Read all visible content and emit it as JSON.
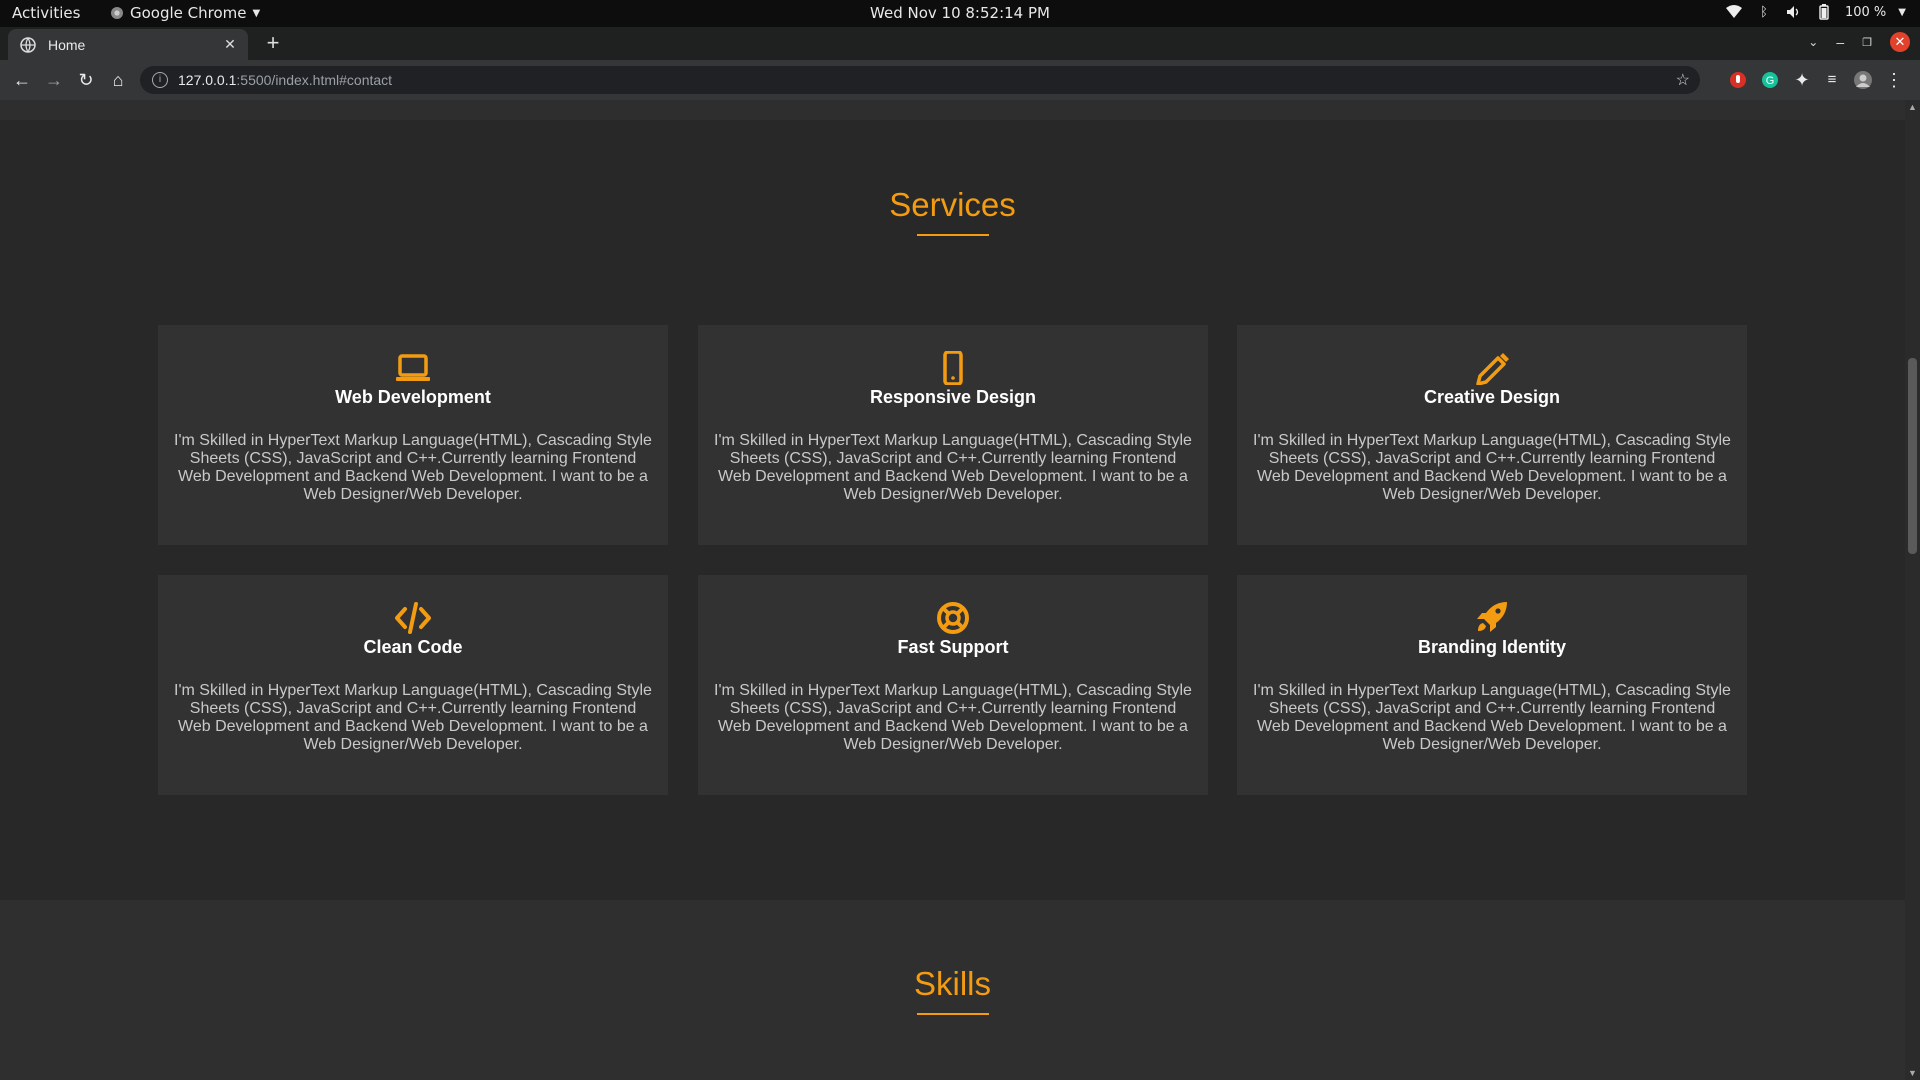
{
  "system_bar": {
    "activities": "Activities",
    "app_name": "Google Chrome",
    "clock": "Wed Nov 10  8:52:14 PM",
    "battery": "100 %"
  },
  "browser": {
    "tab_title": "Home",
    "url_host": "127.0.0.1",
    "url_path": ":5500/index.html#contact"
  },
  "services": {
    "heading": "Services",
    "cards": [
      {
        "title": "Web Development",
        "icon": "laptop-icon",
        "text": "I'm Skilled in HyperText Markup Language(HTML), Cascading Style Sheets (CSS), JavaScript and C++.Currently learning Frontend Web Development and Backend Web Development. I want to be a Web Designer/Web Developer."
      },
      {
        "title": "Responsive Design",
        "icon": "mobile-icon",
        "text": "I'm Skilled in HyperText Markup Language(HTML), Cascading Style Sheets (CSS), JavaScript and C++.Currently learning Frontend Web Development and Backend Web Development. I want to be a Web Designer/Web Developer."
      },
      {
        "title": "Creative Design",
        "icon": "pencil-icon",
        "text": "I'm Skilled in HyperText Markup Language(HTML), Cascading Style Sheets (CSS), JavaScript and C++.Currently learning Frontend Web Development and Backend Web Development. I want to be a Web Designer/Web Developer."
      },
      {
        "title": "Clean Code",
        "icon": "code-icon",
        "text": "I'm Skilled in HyperText Markup Language(HTML), Cascading Style Sheets (CSS), JavaScript and C++.Currently learning Frontend Web Development and Backend Web Development. I want to be a Web Designer/Web Developer."
      },
      {
        "title": "Fast Support",
        "icon": "life-ring-icon",
        "text": "I'm Skilled in HyperText Markup Language(HTML), Cascading Style Sheets (CSS), JavaScript and C++.Currently learning Frontend Web Development and Backend Web Development. I want to be a Web Designer/Web Developer."
      },
      {
        "title": "Branding Identity",
        "icon": "rocket-icon",
        "text": "I'm Skilled in HyperText Markup Language(HTML), Cascading Style Sheets (CSS), JavaScript and C++.Currently learning Frontend Web Development and Backend Web Development. I want to be a Web Designer/Web Developer."
      }
    ]
  },
  "skills": {
    "heading": "Skills"
  },
  "colors": {
    "accent": "#f39c12",
    "background": "#282828",
    "card": "#323232"
  }
}
